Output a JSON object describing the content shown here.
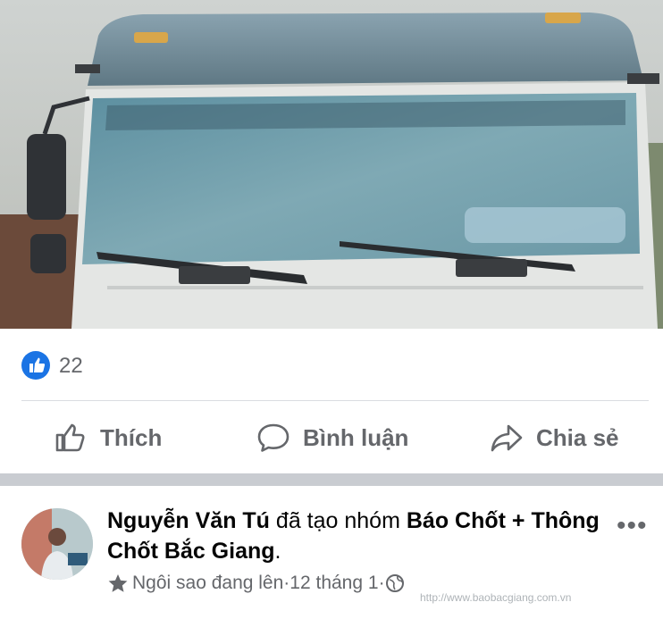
{
  "reactions": {
    "like_count": "22"
  },
  "actions": {
    "like_label": "Thích",
    "comment_label": "Bình luận",
    "share_label": "Chia sẻ"
  },
  "post": {
    "author": "Nguyễn Văn Tú",
    "verb": " đã tạo nhóm ",
    "group_name": "Báo Chốt + Thông Chốt Bắc Giang",
    "period": ".",
    "badge_label": "Ngôi sao đang lên",
    "separator": " · ",
    "date": "12 tháng 1",
    "privacy_icon": "globe-icon",
    "more_label": "•••"
  },
  "watermark": "http://www.baobacgiang.com.vn",
  "icons": [
    "like-icon",
    "comment-icon",
    "share-icon",
    "star-icon",
    "globe-icon"
  ],
  "colors": {
    "facebook_blue": "#1b74e4",
    "secondary_text": "#65676b"
  }
}
